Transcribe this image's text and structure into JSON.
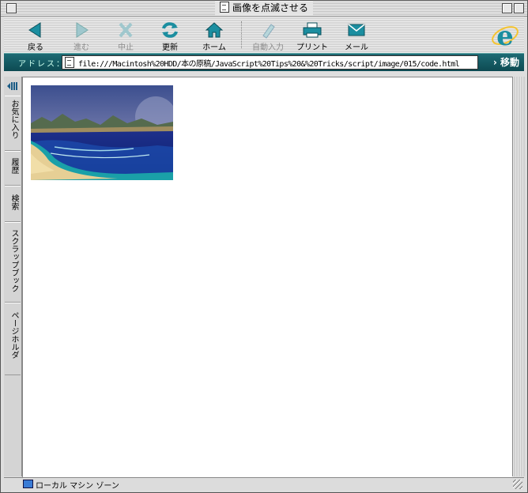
{
  "window": {
    "title": "画像を点滅させる"
  },
  "toolbar": {
    "buttons": [
      {
        "label": "戻る",
        "icon": "back-arrow-icon",
        "enabled": true
      },
      {
        "label": "進む",
        "icon": "forward-arrow-icon",
        "enabled": false
      },
      {
        "label": "中止",
        "icon": "stop-icon",
        "enabled": false
      },
      {
        "label": "更新",
        "icon": "refresh-icon",
        "enabled": true
      },
      {
        "label": "ホーム",
        "icon": "home-icon",
        "enabled": true
      },
      {
        "label": "自動入力",
        "icon": "autofill-icon",
        "enabled": false
      },
      {
        "label": "プリント",
        "icon": "print-icon",
        "enabled": true
      },
      {
        "label": "メール",
        "icon": "mail-icon",
        "enabled": true
      }
    ],
    "logo": "ie-logo"
  },
  "address": {
    "label": "アドレス：",
    "url": "file:///Macintosh%20HDD/本の原稿/JavaScript%20Tips%20&%20Tricks/script/image/015/code.html",
    "go_label": "移動"
  },
  "explorer": {
    "tabs": [
      "お気に入り",
      "履歴",
      "検索",
      "スクラップブック",
      "ページホルダ"
    ]
  },
  "content": {
    "image": "beach-landscape-image"
  },
  "status": {
    "zone": "ローカル マシン ゾーン"
  },
  "colors": {
    "accent": "#0d4a52",
    "icon_teal": "#1b8ea0"
  }
}
